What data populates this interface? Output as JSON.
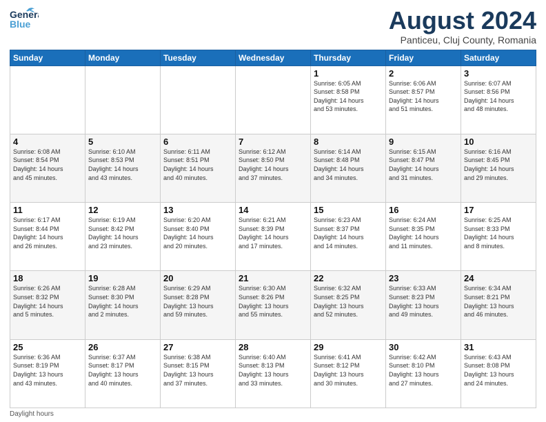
{
  "logo": {
    "line1": "General",
    "line2": "Blue"
  },
  "title": "August 2024",
  "subtitle": "Panticeu, Cluj County, Romania",
  "days_header": [
    "Sunday",
    "Monday",
    "Tuesday",
    "Wednesday",
    "Thursday",
    "Friday",
    "Saturday"
  ],
  "footer": "Daylight hours",
  "weeks": [
    [
      {
        "day": "",
        "info": ""
      },
      {
        "day": "",
        "info": ""
      },
      {
        "day": "",
        "info": ""
      },
      {
        "day": "",
        "info": ""
      },
      {
        "day": "1",
        "info": "Sunrise: 6:05 AM\nSunset: 8:58 PM\nDaylight: 14 hours\nand 53 minutes."
      },
      {
        "day": "2",
        "info": "Sunrise: 6:06 AM\nSunset: 8:57 PM\nDaylight: 14 hours\nand 51 minutes."
      },
      {
        "day": "3",
        "info": "Sunrise: 6:07 AM\nSunset: 8:56 PM\nDaylight: 14 hours\nand 48 minutes."
      }
    ],
    [
      {
        "day": "4",
        "info": "Sunrise: 6:08 AM\nSunset: 8:54 PM\nDaylight: 14 hours\nand 45 minutes."
      },
      {
        "day": "5",
        "info": "Sunrise: 6:10 AM\nSunset: 8:53 PM\nDaylight: 14 hours\nand 43 minutes."
      },
      {
        "day": "6",
        "info": "Sunrise: 6:11 AM\nSunset: 8:51 PM\nDaylight: 14 hours\nand 40 minutes."
      },
      {
        "day": "7",
        "info": "Sunrise: 6:12 AM\nSunset: 8:50 PM\nDaylight: 14 hours\nand 37 minutes."
      },
      {
        "day": "8",
        "info": "Sunrise: 6:14 AM\nSunset: 8:48 PM\nDaylight: 14 hours\nand 34 minutes."
      },
      {
        "day": "9",
        "info": "Sunrise: 6:15 AM\nSunset: 8:47 PM\nDaylight: 14 hours\nand 31 minutes."
      },
      {
        "day": "10",
        "info": "Sunrise: 6:16 AM\nSunset: 8:45 PM\nDaylight: 14 hours\nand 29 minutes."
      }
    ],
    [
      {
        "day": "11",
        "info": "Sunrise: 6:17 AM\nSunset: 8:44 PM\nDaylight: 14 hours\nand 26 minutes."
      },
      {
        "day": "12",
        "info": "Sunrise: 6:19 AM\nSunset: 8:42 PM\nDaylight: 14 hours\nand 23 minutes."
      },
      {
        "day": "13",
        "info": "Sunrise: 6:20 AM\nSunset: 8:40 PM\nDaylight: 14 hours\nand 20 minutes."
      },
      {
        "day": "14",
        "info": "Sunrise: 6:21 AM\nSunset: 8:39 PM\nDaylight: 14 hours\nand 17 minutes."
      },
      {
        "day": "15",
        "info": "Sunrise: 6:23 AM\nSunset: 8:37 PM\nDaylight: 14 hours\nand 14 minutes."
      },
      {
        "day": "16",
        "info": "Sunrise: 6:24 AM\nSunset: 8:35 PM\nDaylight: 14 hours\nand 11 minutes."
      },
      {
        "day": "17",
        "info": "Sunrise: 6:25 AM\nSunset: 8:33 PM\nDaylight: 14 hours\nand 8 minutes."
      }
    ],
    [
      {
        "day": "18",
        "info": "Sunrise: 6:26 AM\nSunset: 8:32 PM\nDaylight: 14 hours\nand 5 minutes."
      },
      {
        "day": "19",
        "info": "Sunrise: 6:28 AM\nSunset: 8:30 PM\nDaylight: 14 hours\nand 2 minutes."
      },
      {
        "day": "20",
        "info": "Sunrise: 6:29 AM\nSunset: 8:28 PM\nDaylight: 13 hours\nand 59 minutes."
      },
      {
        "day": "21",
        "info": "Sunrise: 6:30 AM\nSunset: 8:26 PM\nDaylight: 13 hours\nand 55 minutes."
      },
      {
        "day": "22",
        "info": "Sunrise: 6:32 AM\nSunset: 8:25 PM\nDaylight: 13 hours\nand 52 minutes."
      },
      {
        "day": "23",
        "info": "Sunrise: 6:33 AM\nSunset: 8:23 PM\nDaylight: 13 hours\nand 49 minutes."
      },
      {
        "day": "24",
        "info": "Sunrise: 6:34 AM\nSunset: 8:21 PM\nDaylight: 13 hours\nand 46 minutes."
      }
    ],
    [
      {
        "day": "25",
        "info": "Sunrise: 6:36 AM\nSunset: 8:19 PM\nDaylight: 13 hours\nand 43 minutes."
      },
      {
        "day": "26",
        "info": "Sunrise: 6:37 AM\nSunset: 8:17 PM\nDaylight: 13 hours\nand 40 minutes."
      },
      {
        "day": "27",
        "info": "Sunrise: 6:38 AM\nSunset: 8:15 PM\nDaylight: 13 hours\nand 37 minutes."
      },
      {
        "day": "28",
        "info": "Sunrise: 6:40 AM\nSunset: 8:13 PM\nDaylight: 13 hours\nand 33 minutes."
      },
      {
        "day": "29",
        "info": "Sunrise: 6:41 AM\nSunset: 8:12 PM\nDaylight: 13 hours\nand 30 minutes."
      },
      {
        "day": "30",
        "info": "Sunrise: 6:42 AM\nSunset: 8:10 PM\nDaylight: 13 hours\nand 27 minutes."
      },
      {
        "day": "31",
        "info": "Sunrise: 6:43 AM\nSunset: 8:08 PM\nDaylight: 13 hours\nand 24 minutes."
      }
    ]
  ]
}
